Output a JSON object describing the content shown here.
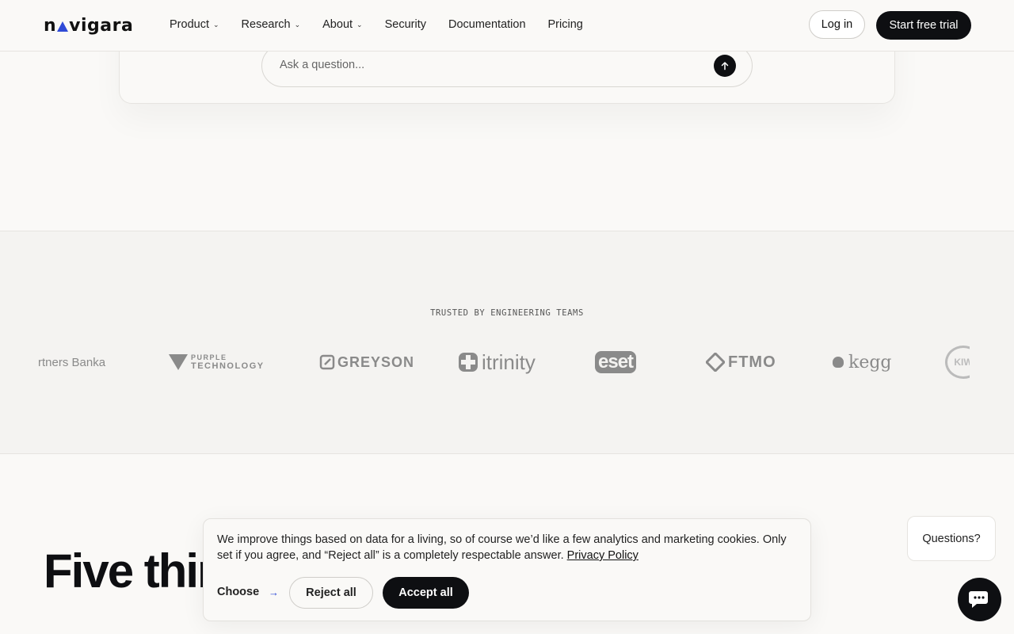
{
  "nav": {
    "logo_left": "n",
    "logo_right": "vigara",
    "items": [
      {
        "label": "Product",
        "has_dropdown": true
      },
      {
        "label": "Research",
        "has_dropdown": true
      },
      {
        "label": "About",
        "has_dropdown": true
      },
      {
        "label": "Security",
        "has_dropdown": false
      },
      {
        "label": "Documentation",
        "has_dropdown": false
      },
      {
        "label": "Pricing",
        "has_dropdown": false
      }
    ],
    "login_label": "Log in",
    "trial_label": "Start free trial"
  },
  "ask": {
    "placeholder": "Ask a question...",
    "send_icon": "arrow-up-icon"
  },
  "trusted": {
    "title": "TRUSTED BY ENGINEERING TEAMS",
    "logos": [
      {
        "name": "Partners Banka",
        "text": "rtners Banka"
      },
      {
        "name": "Purple Technology",
        "text_top": "PURPLE",
        "text_bottom": "TECHNOLOGY"
      },
      {
        "name": "Greyson",
        "text": "GREYSON"
      },
      {
        "name": "itrinity",
        "text": "itrinity"
      },
      {
        "name": "ESET",
        "text": "eset"
      },
      {
        "name": "FTMO",
        "text": "FTMO"
      },
      {
        "name": "kegg",
        "text": "kegg"
      },
      {
        "name": "Kiwi",
        "text": "KIW"
      }
    ]
  },
  "section": {
    "headline": "Five thin"
  },
  "cookie": {
    "text": "We improve things based on data for a living, so of course we’d like a few analytics and marketing cookies. Only set if you agree, and “Reject all” is a completely respectable answer.",
    "link": "Privacy Policy",
    "choose_label": "Choose",
    "reject_label": "Reject all",
    "accept_label": "Accept all"
  },
  "support": {
    "questions_label": "Questions?",
    "chat_icon": "chat-bubble-icon"
  },
  "colors": {
    "accent": "#2f4ad6",
    "dark": "#0e0f12",
    "background": "#faf9f7"
  }
}
